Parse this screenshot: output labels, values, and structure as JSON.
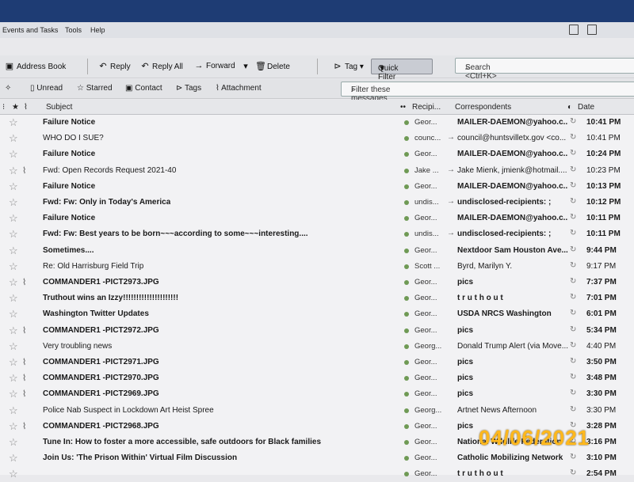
{
  "menu": {
    "events": "Events and Tasks",
    "tools": "Tools",
    "help": "Help"
  },
  "toolbar": {
    "address_book": "Address Book",
    "reply": "Reply",
    "reply_all": "Reply All",
    "forward": "Forward",
    "delete": "Delete",
    "tag": "Tag",
    "quick_filter": "Quick Filter",
    "search_placeholder": "Search <Ctrl+K>"
  },
  "filterbar": {
    "unread": "Unread",
    "starred": "Starred",
    "contact": "Contact",
    "tags": "Tags",
    "attachment": "Attachment",
    "filter_placeholder": "Filter these messages <Ctrl+Shift+K>"
  },
  "columns": {
    "subject": "Subject",
    "recipient": "Recipi...",
    "correspondents": "Correspondents",
    "date": "Date"
  },
  "messages": [
    {
      "subject": "Failure Notice",
      "recipient": "Geor...",
      "correspondent": "MAILER-DAEMON@yahoo.c...",
      "date": "10:41 PM",
      "bold": true,
      "attach": false,
      "arrow": false
    },
    {
      "subject": "WHO DO I SUE?",
      "recipient": "counc...",
      "correspondent": "council@huntsvilletx.gov <co...",
      "date": "10:41 PM",
      "bold": false,
      "attach": false,
      "arrow": true
    },
    {
      "subject": "Failure Notice",
      "recipient": "Geor...",
      "correspondent": "MAILER-DAEMON@yahoo.c...",
      "date": "10:24 PM",
      "bold": true,
      "attach": false,
      "arrow": false
    },
    {
      "subject": "Fwd: Open Records Request 2021-40",
      "recipient": "Jake ...",
      "correspondent": "Jake Mienk, jmienk@hotmail....",
      "date": "10:23 PM",
      "bold": false,
      "attach": true,
      "arrow": true
    },
    {
      "subject": "Failure Notice",
      "recipient": "Geor...",
      "correspondent": "MAILER-DAEMON@yahoo.c...",
      "date": "10:13 PM",
      "bold": true,
      "attach": false,
      "arrow": false
    },
    {
      "subject": "Fwd: Fw: Only in Today's America",
      "recipient": "undis...",
      "correspondent": "undisclosed-recipients: ;",
      "date": "10:12 PM",
      "bold": true,
      "attach": false,
      "arrow": true
    },
    {
      "subject": "Failure Notice",
      "recipient": "Geor...",
      "correspondent": "MAILER-DAEMON@yahoo.c...",
      "date": "10:11 PM",
      "bold": true,
      "attach": false,
      "arrow": false
    },
    {
      "subject": "Fwd: Fw: Best years to be born~~~according to some~~~interesting....",
      "recipient": "undis...",
      "correspondent": "undisclosed-recipients: ;",
      "date": "10:11 PM",
      "bold": true,
      "attach": false,
      "arrow": true
    },
    {
      "subject": "Sometimes....",
      "recipient": "Geor...",
      "correspondent": "Nextdoor Sam Houston Ave...",
      "date": "9:44 PM",
      "bold": true,
      "attach": false,
      "arrow": false
    },
    {
      "subject": "Re: Old Harrisburg Field Trip",
      "recipient": "Scott ...",
      "correspondent": "Byrd, Marilyn Y.",
      "date": "9:17 PM",
      "bold": false,
      "attach": false,
      "arrow": false
    },
    {
      "subject": "COMMANDER1 -PICT2973.JPG",
      "recipient": "Geor...",
      "correspondent": "pics",
      "date": "7:37 PM",
      "bold": true,
      "attach": true,
      "arrow": false
    },
    {
      "subject": "Truthout wins an Izzy!!!!!!!!!!!!!!!!!!!!!",
      "recipient": "Geor...",
      "correspondent": "t r u t h o u t",
      "date": "7:01 PM",
      "bold": true,
      "attach": false,
      "arrow": false
    },
    {
      "subject": "Washington Twitter Updates",
      "recipient": "Geor...",
      "correspondent": "USDA NRCS Washington",
      "date": "6:01 PM",
      "bold": true,
      "attach": false,
      "arrow": false
    },
    {
      "subject": "COMMANDER1 -PICT2972.JPG",
      "recipient": "Geor...",
      "correspondent": "pics",
      "date": "5:34 PM",
      "bold": true,
      "attach": true,
      "arrow": false
    },
    {
      "subject": "Very troubling news",
      "recipient": "Georg...",
      "correspondent": "Donald Trump Alert (via Move...",
      "date": "4:40 PM",
      "bold": false,
      "attach": false,
      "arrow": false
    },
    {
      "subject": "COMMANDER1 -PICT2971.JPG",
      "recipient": "Geor...",
      "correspondent": "pics",
      "date": "3:50 PM",
      "bold": true,
      "attach": true,
      "arrow": false
    },
    {
      "subject": "COMMANDER1 -PICT2970.JPG",
      "recipient": "Geor...",
      "correspondent": "pics",
      "date": "3:48 PM",
      "bold": true,
      "attach": true,
      "arrow": false
    },
    {
      "subject": "COMMANDER1 -PICT2969.JPG",
      "recipient": "Geor...",
      "correspondent": "pics",
      "date": "3:30 PM",
      "bold": true,
      "attach": true,
      "arrow": false
    },
    {
      "subject": "Police Nab Suspect in Lockdown Art Heist Spree",
      "recipient": "Georg...",
      "correspondent": "Artnet News Afternoon",
      "date": "3:30 PM",
      "bold": false,
      "attach": false,
      "arrow": false
    },
    {
      "subject": "COMMANDER1 -PICT2968.JPG",
      "recipient": "Geor...",
      "correspondent": "pics",
      "date": "3:28 PM",
      "bold": true,
      "attach": true,
      "arrow": false
    },
    {
      "subject": "Tune In: How to foster a more accessible, safe outdoors for Black families",
      "recipient": "Geor...",
      "correspondent": "National Wildlife Federation",
      "date": "3:16 PM",
      "bold": true,
      "attach": false,
      "arrow": false
    },
    {
      "subject": "Join Us: 'The Prison Within' Virtual Film Discussion",
      "recipient": "Geor...",
      "correspondent": "Catholic Mobilizing Network",
      "date": "3:10 PM",
      "bold": true,
      "attach": false,
      "arrow": false
    },
    {
      "subject": "",
      "recipient": "Geor...",
      "correspondent": "t r u t h o u t",
      "date": "2:54 PM",
      "bold": true,
      "attach": false,
      "arrow": false
    }
  ],
  "stamp": "04/06/2021"
}
